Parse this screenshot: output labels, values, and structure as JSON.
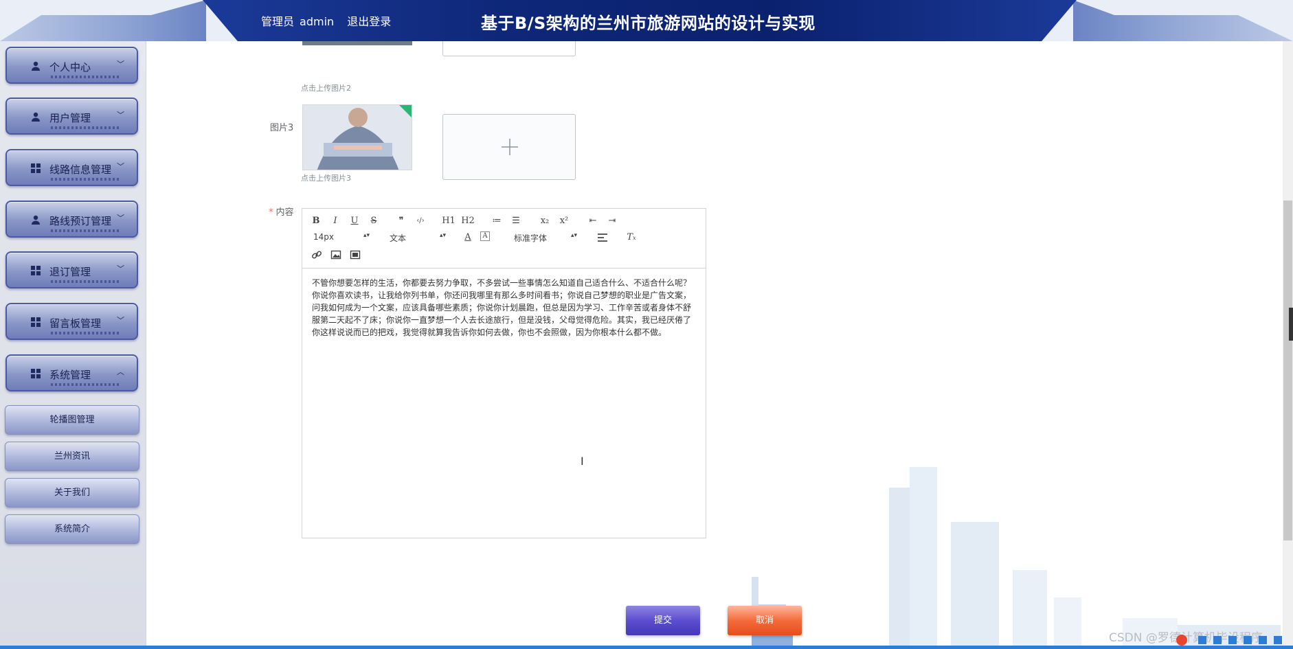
{
  "header": {
    "role_label": "管理员",
    "username": "admin",
    "logout_label": "退出登录",
    "site_title": "基于B/S架构的兰州市旅游网站的设计与实现"
  },
  "sidebar": {
    "menus": [
      {
        "label": "个人中心",
        "icon": "user-icon",
        "expanded": false
      },
      {
        "label": "用户管理",
        "icon": "user-icon",
        "expanded": false
      },
      {
        "label": "线路信息管理",
        "icon": "grid-icon",
        "expanded": false
      },
      {
        "label": "路线预订管理",
        "icon": "user-icon",
        "expanded": false
      },
      {
        "label": "退订管理",
        "icon": "grid-icon",
        "expanded": false
      },
      {
        "label": "留言板管理",
        "icon": "grid-icon",
        "expanded": false
      },
      {
        "label": "系统管理",
        "icon": "grid-icon",
        "expanded": true
      }
    ],
    "submenu": [
      {
        "label": "轮播图管理"
      },
      {
        "label": "兰州资讯"
      },
      {
        "label": "关于我们"
      },
      {
        "label": "系统简介"
      }
    ]
  },
  "form": {
    "hint_image2": "点击上传图片2",
    "image3_label": "图片3",
    "hint_image3": "点击上传图片3",
    "content_label": "内容",
    "content_required": "*"
  },
  "editor": {
    "toolbar_row1": [
      "B",
      "I",
      "U",
      "S",
      "❞",
      "‹/›",
      "H1",
      "H2",
      "≔",
      "☰",
      "x₂",
      "x²",
      "⇤",
      "⇥"
    ],
    "font_size": "14px",
    "paragraph_format": "文本",
    "font_family": "标准字体",
    "text": "不管你想要怎样的生活，你都要去努力争取，不多尝试一些事情怎么知道自己适合什么、不适合什么呢？你说你喜欢读书，让我给你列书单，你还问我哪里有那么多时间看书；你说自己梦想的职业是广告文案，问我如何成为一个文案，应该具备哪些素质；你说你计划晨跑，但总是因为学习、工作辛苦或者身体不舒服第二天起不了床；你说你一直梦想一个人去长途旅行，但是没钱，父母觉得危险。其实，我已经厌倦了你这样说说而已的把戏，我觉得就算我告诉你如何去做，你也不会照做，因为你根本什么都不做。"
  },
  "buttons": {
    "submit_label": "提交",
    "cancel_label": "取消"
  },
  "watermark": "CSDN @罗德计算机毕设程序",
  "colors": {
    "header_bg": "#0e2778",
    "submit": "#5b4fcf",
    "cancel": "#f46b3c",
    "required": "#f56c6c"
  }
}
